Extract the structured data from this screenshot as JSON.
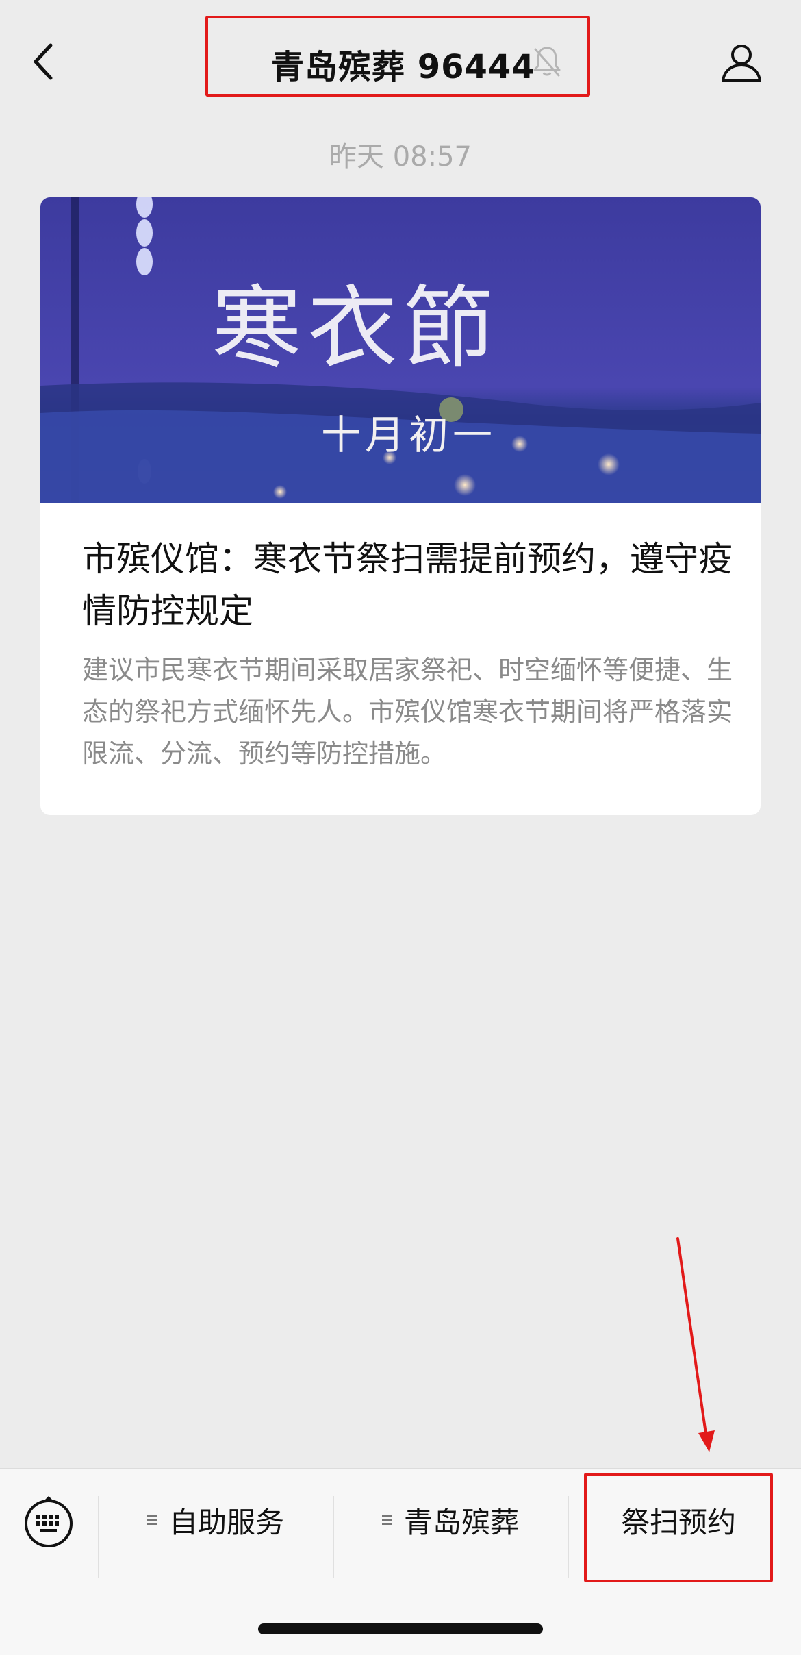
{
  "header": {
    "title": "青岛殡葬 96444",
    "back_icon": "chevron-left-icon",
    "mute_icon": "bell-slash-icon",
    "profile_icon": "person-icon"
  },
  "timestamp": "昨天 08:57",
  "article": {
    "banner_title": "寒衣節",
    "banner_subtitle": "十月初一",
    "title": "市殡仪馆：寒衣节祭扫需提前预约，遵守疫情防控规定",
    "summary": "建议市民寒衣节期间采取居家祭祀、时空缅怀等便捷、生态的祭祀方式缅怀先人。市殡仪馆寒衣节期间将严格落实限流、分流、预约等防控措施。"
  },
  "bottom_menu": {
    "keyboard_icon": "keyboard-icon",
    "items": [
      {
        "label": "自助服务",
        "has_submenu": true
      },
      {
        "label": "青岛殡葬",
        "has_submenu": true
      },
      {
        "label": "祭扫预约",
        "has_submenu": false
      }
    ]
  },
  "colors": {
    "background": "#ececec",
    "highlight": "#e21a1a",
    "banner_top": "#3d3b9f",
    "banner_bottom": "#2b3a8c"
  }
}
